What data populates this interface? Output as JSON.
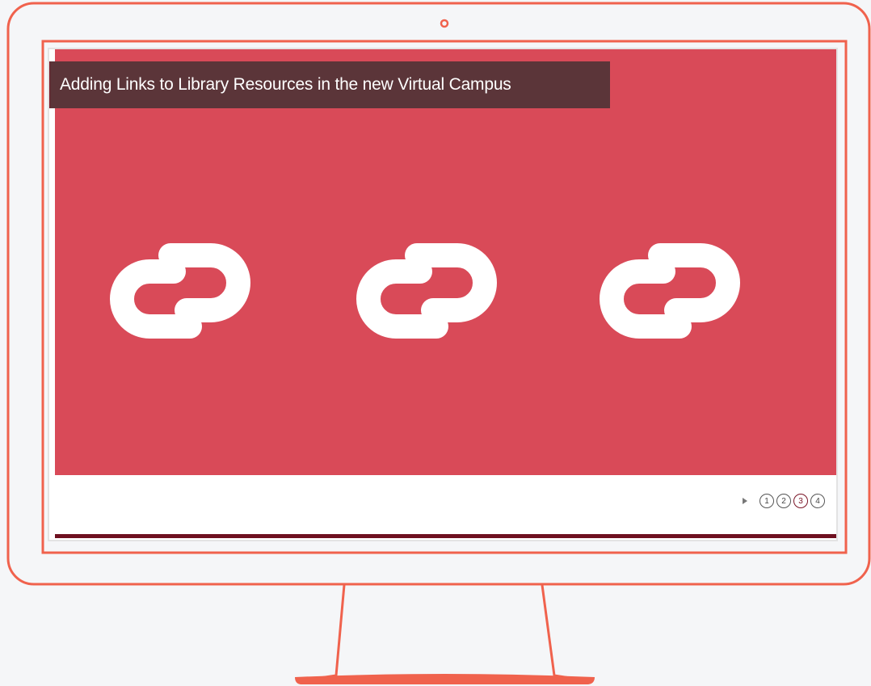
{
  "slide": {
    "title": "Adding Links to Library Resources in the new Virtual Campus",
    "background_color": "#d94a58",
    "title_bar_color": "#5b3539",
    "accent_color": "#7a1426",
    "icons": [
      "link-icon",
      "link-icon",
      "link-icon"
    ]
  },
  "controls": {
    "play_icon": "play-icon",
    "pages": [
      {
        "label": "1",
        "active": false
      },
      {
        "label": "2",
        "active": false
      },
      {
        "label": "3",
        "active": true
      },
      {
        "label": "4",
        "active": false
      }
    ]
  },
  "monitor": {
    "outline_color": "#f0624d"
  }
}
